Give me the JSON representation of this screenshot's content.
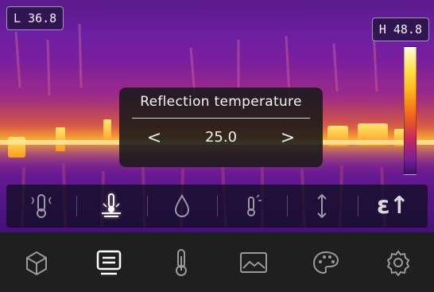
{
  "readouts": {
    "min_prefix": "L",
    "min_value": "36.8",
    "max_prefix": "H",
    "max_value": "48.8"
  },
  "dialog": {
    "title": "Reflection temperature",
    "value": "25.0",
    "prev_glyph": "<",
    "next_glyph": ">"
  },
  "sub_menu": {
    "items": [
      {
        "icon": "emissivity-thermometer-icon"
      },
      {
        "icon": "reflection-temperature-icon",
        "active": true
      },
      {
        "icon": "atmosphere-humidity-icon"
      },
      {
        "icon": "ambient-temperature-icon"
      },
      {
        "icon": "distance-icon"
      },
      {
        "icon": "emissivity-epsilon-icon",
        "label": "ε↑"
      }
    ]
  },
  "toolbar": {
    "items": [
      {
        "icon": "measurement-box-icon"
      },
      {
        "icon": "parameters-display-icon",
        "active": true
      },
      {
        "icon": "thermometer-icon"
      },
      {
        "icon": "image-gallery-icon"
      },
      {
        "icon": "color-palette-icon"
      },
      {
        "icon": "settings-gear-icon"
      }
    ]
  },
  "colors": {
    "accent": "#ffffff",
    "toolbar_bg": "#1f1f1f",
    "dialog_bg": "#191919",
    "thermal_base": "#6b1fa0",
    "thermal_hot": "#ffd23a"
  }
}
